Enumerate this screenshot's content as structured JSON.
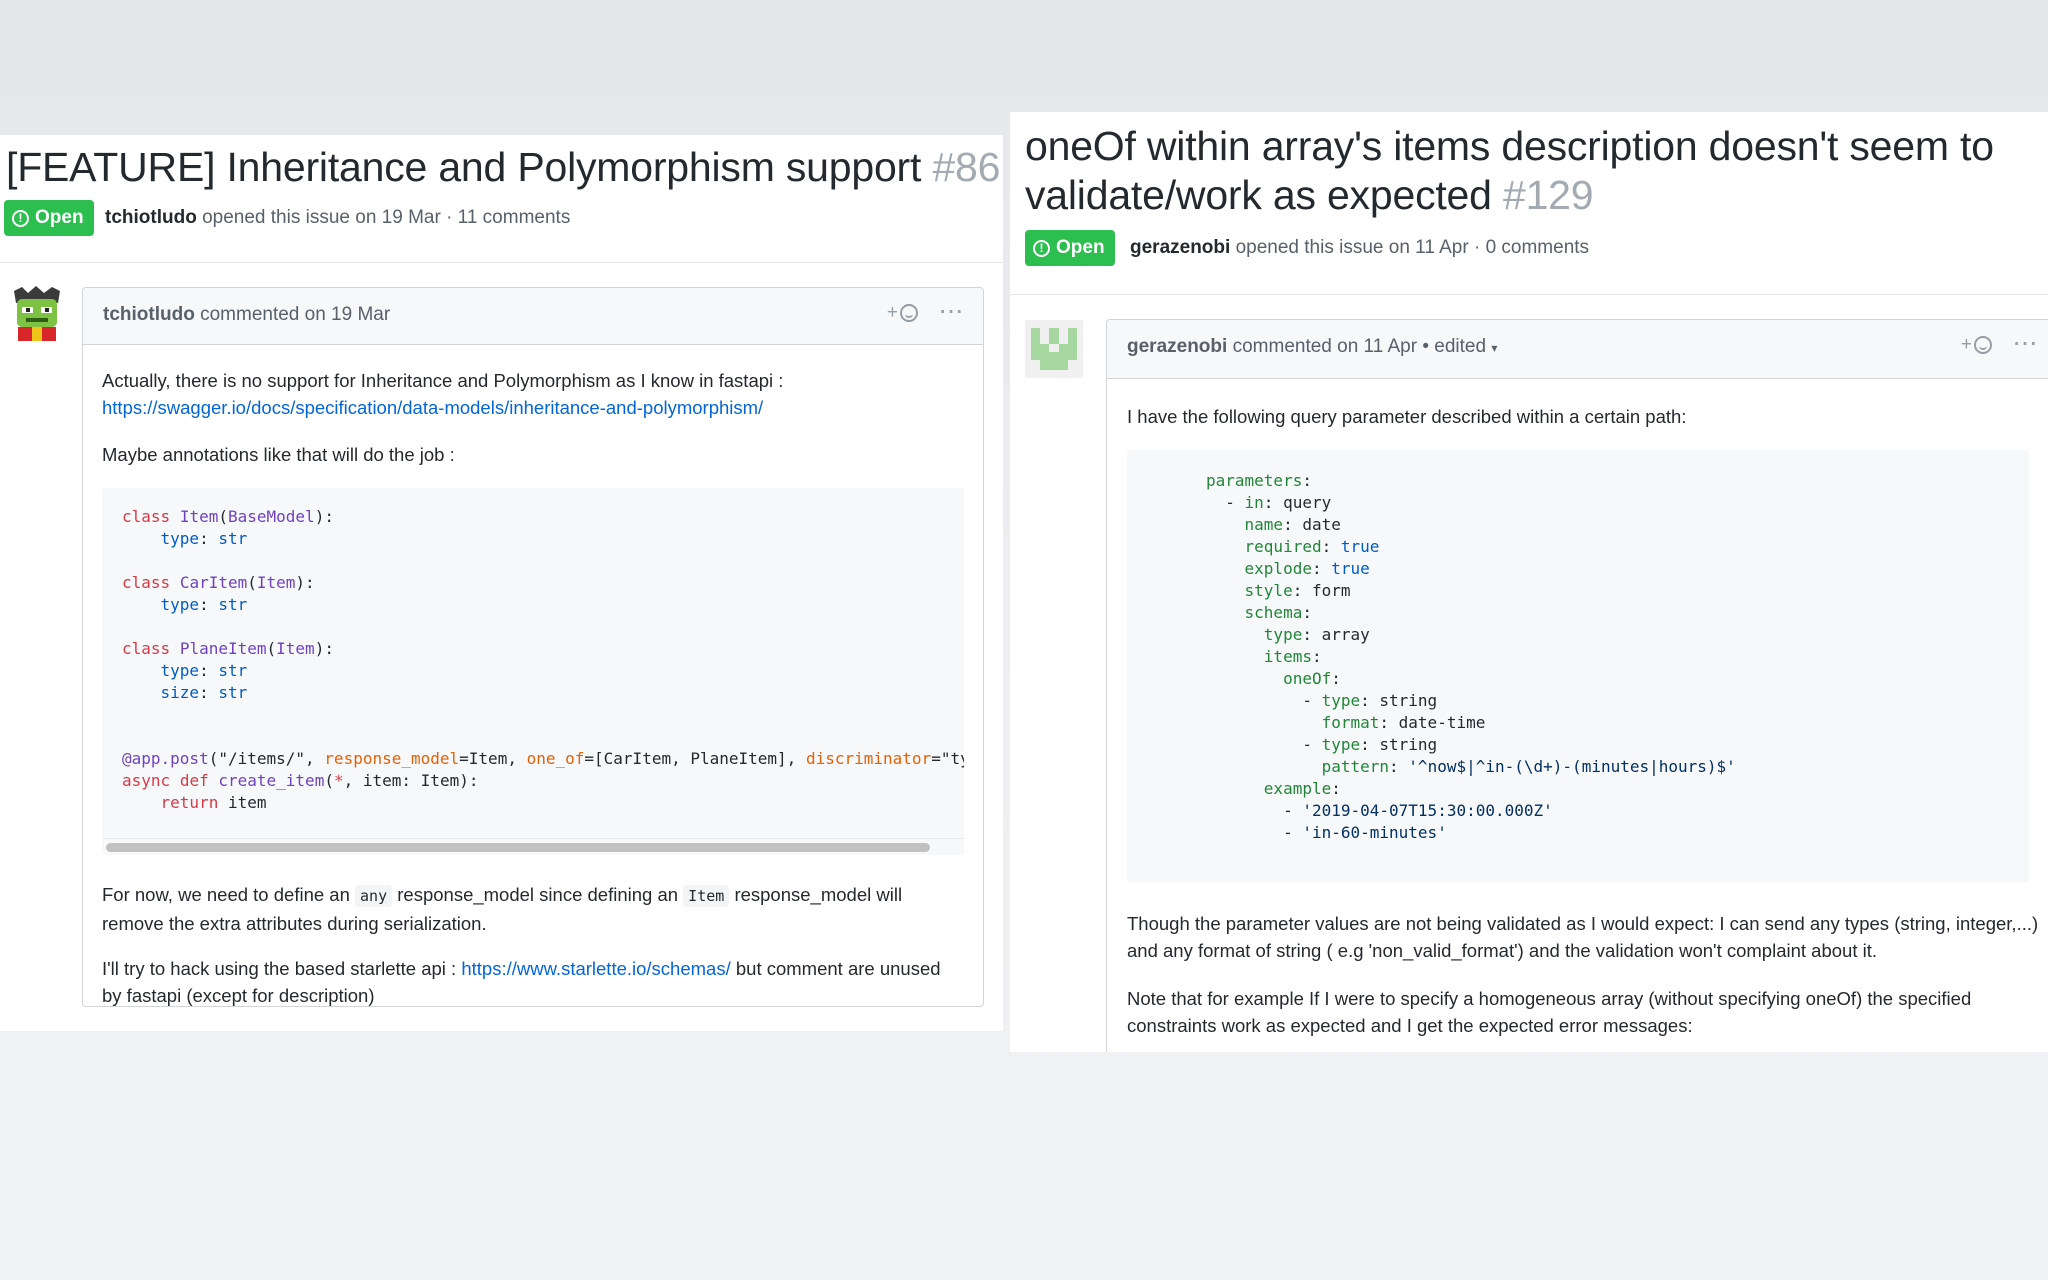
{
  "left": {
    "title": "[FEATURE] Inheritance and Polymorphism support",
    "number": "#86",
    "state": "Open",
    "author": "tchiotludo",
    "opened_text": "opened this issue on 19 Mar · 11 comments",
    "comment": {
      "author": "tchiotludo",
      "date_text": "commented on 19 Mar",
      "para1": "Actually, there is no support for Inheritance and Polymorphism as I know in fastapi :",
      "link1": "https://swagger.io/docs/specification/data-models/inheritance-and-polymorphism/",
      "para2": "Maybe annotations like that will do the job :",
      "para3_a": "For now, we need to define an",
      "para3_code1": "any",
      "para3_b": "response_model since defining an",
      "para3_code2": "Item",
      "para3_c": "response_model will remove the extra attributes during serialization.",
      "para4_a": "I'll try to hack using the based starlette api :",
      "link2": "https://www.starlette.io/schemas/",
      "para4_b": "but comment are unused by fastapi (except for description)"
    }
  },
  "right": {
    "title_line1": "oneOf within array's items description doesn't seem to",
    "title_line2": "validate/work as expected",
    "number": "#129",
    "state": "Open",
    "author": "gerazenobi",
    "opened_text": "opened this issue on 11 Apr · 0 comments",
    "comment": {
      "author": "gerazenobi",
      "date_text": "commented on 11 Apr",
      "edited": "• edited",
      "para1": "I have the following query parameter described within a certain path:",
      "para2": "Though the parameter values are not being validated as I would expect: I can send any types (string, integer,...) and any format of string ( e.g 'non_valid_format') and the validation won't complaint about it.",
      "para3": "Note that for example If I were to specify a homogeneous array (without specifying oneOf) the specified constraints work as expected and I get the expected error messages:"
    }
  },
  "ui": {
    "reaction_plus": "+",
    "more_dots": "···",
    "open_icon": "!",
    "badge_color": "#2cbe4e",
    "link_color": "#0366d6"
  }
}
